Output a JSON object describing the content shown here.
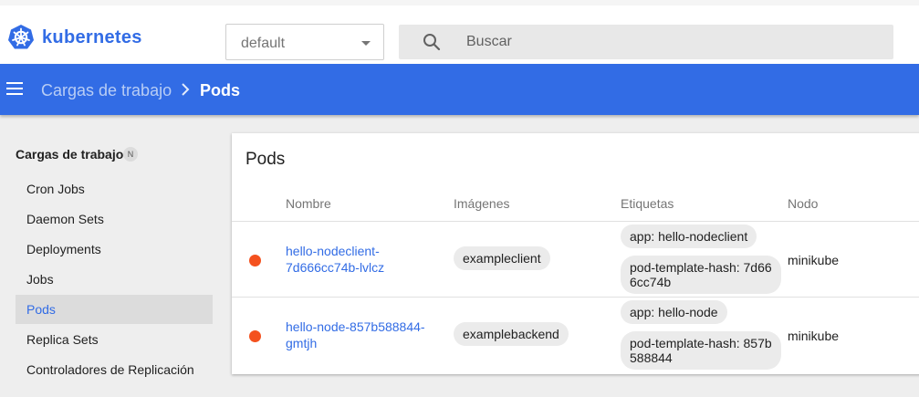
{
  "header": {
    "logo_text": "kubernetes",
    "namespace": "default",
    "search_placeholder": "Buscar"
  },
  "toolbar": {
    "breadcrumb_parent": "Cargas de trabajo",
    "breadcrumb_current": "Pods"
  },
  "sidebar": {
    "section_title": "Cargas de trabajo",
    "section_badge": "N",
    "items": [
      {
        "label": "Cron Jobs"
      },
      {
        "label": "Daemon Sets"
      },
      {
        "label": "Deployments"
      },
      {
        "label": "Jobs"
      },
      {
        "label": "Pods",
        "active": true
      },
      {
        "label": "Replica Sets"
      },
      {
        "label": "Controladores de Replicación"
      }
    ]
  },
  "pods": {
    "title": "Pods",
    "columns": [
      "Nombre",
      "Imágenes",
      "Etiquetas",
      "Nodo"
    ],
    "rows": [
      {
        "status_color": "#f4511e",
        "name_line1": "hello-nodeclient-",
        "name_line2": "7d666cc74b-lvlcz",
        "image": "exampleclient",
        "label1": "app: hello-nodeclient",
        "label2_line1": "pod-template-hash: 7d66",
        "label2_line2": "6cc74b",
        "node": "minikube"
      },
      {
        "status_color": "#f4511e",
        "name_line1": "hello-node-857b588844-",
        "name_line2": "gmtjh",
        "image": "examplebackend",
        "label1": "app: hello-node",
        "label2_line1": "pod-template-hash: 857b",
        "label2_line2": "588844",
        "node": "minikube"
      }
    ]
  },
  "colors": {
    "brand": "#326ce5",
    "status_error": "#f4511e"
  }
}
